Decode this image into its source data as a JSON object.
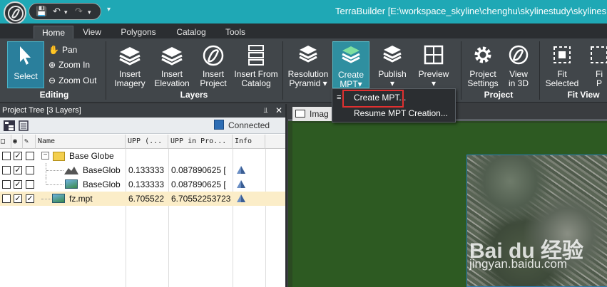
{
  "window": {
    "title": "TerraBuilder [E:\\workspace_skyline\\chenghu\\skylinestudy\\skylines"
  },
  "ribbon": {
    "tabs": [
      {
        "label": "Home"
      },
      {
        "label": "View"
      },
      {
        "label": "Polygons"
      },
      {
        "label": "Catalog"
      },
      {
        "label": "Tools"
      }
    ],
    "editing": {
      "group_label": "Editing",
      "select": "Select",
      "pan": "Pan",
      "zoom_in": "Zoom In",
      "zoom_out": "Zoom Out"
    },
    "layers": {
      "group_label": "Layers",
      "insert_imagery": [
        "Insert",
        "Imagery"
      ],
      "insert_elevation": [
        "Insert",
        "Elevation"
      ],
      "insert_project": [
        "Insert",
        "Project"
      ],
      "insert_from_catalog": [
        "Insert From",
        "Catalog"
      ]
    },
    "mpt": {
      "resolution_pyramid": [
        "Resolution",
        "Pyramid"
      ],
      "create_mpt": [
        "Create",
        "MPT"
      ],
      "publish": [
        "Publish",
        ""
      ],
      "preview": [
        "Preview",
        ""
      ]
    },
    "project": {
      "group_label": "Project",
      "project_settings": [
        "Project",
        "Settings"
      ],
      "view_in_3d": [
        "View",
        "in 3D"
      ]
    },
    "fit_view": {
      "group_label": "Fit View",
      "fit_selected": [
        "Fit",
        "Selected"
      ],
      "fit_more": [
        "Fi",
        "P"
      ]
    }
  },
  "dropdown": {
    "items": [
      {
        "label": "Create MPT..."
      },
      {
        "label": "Resume MPT Creation..."
      }
    ]
  },
  "project_tree": {
    "header": "Project Tree [3 Layers]",
    "status": "Connected",
    "columns": [
      "Name",
      "UPP (...",
      "UPP in Pro...",
      "Info"
    ],
    "rows": [
      {
        "name": "Base Globe",
        "upp": "",
        "upp_proj": "",
        "checks": [
          false,
          true,
          false
        ],
        "type": "folder"
      },
      {
        "name": "BaseGlob",
        "upp": "0.133333",
        "upp_proj": "0.087890625 [",
        "checks": [
          false,
          true,
          false
        ],
        "type": "elevation"
      },
      {
        "name": "BaseGlob",
        "upp": "0.133333",
        "upp_proj": "0.087890625 [",
        "checks": [
          false,
          true,
          false
        ],
        "type": "imagery"
      },
      {
        "name": "fz.mpt",
        "upp": "6.705522",
        "upp_proj": "6.70552253723",
        "checks": [
          false,
          true,
          true
        ],
        "type": "imagery"
      }
    ]
  },
  "map_view": {
    "tab_label": "Imag"
  },
  "watermark": {
    "line1": "Bai du 经验",
    "line2": "jingyan.baidu.com"
  }
}
